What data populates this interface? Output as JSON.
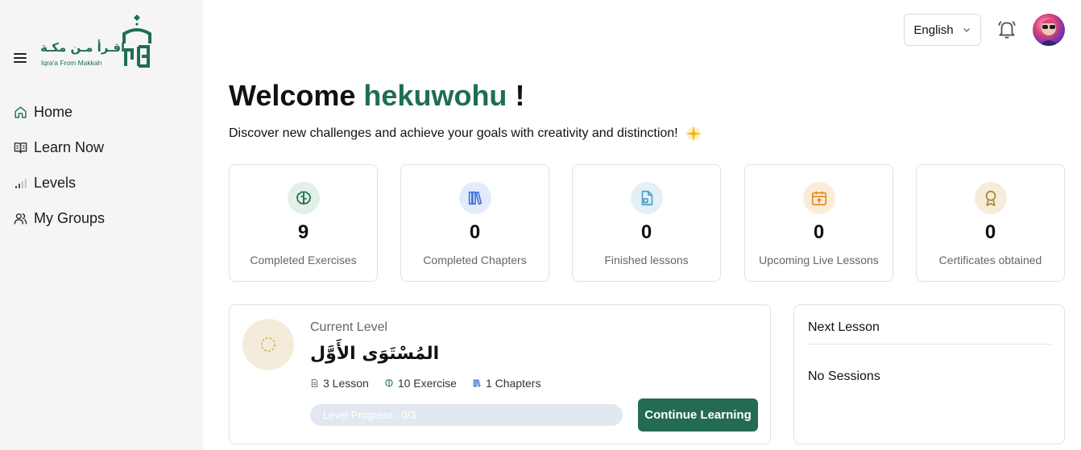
{
  "brand": {
    "name_ar": "اقـرأ مـن مكـة",
    "name_en": "Iqra'a From Makkah",
    "color": "#1f6f4f"
  },
  "sidebar": {
    "items": [
      {
        "label": "Home",
        "icon": "home-icon"
      },
      {
        "label": "Learn Now",
        "icon": "book-open-icon"
      },
      {
        "label": "Levels",
        "icon": "signal-bars-icon"
      },
      {
        "label": "My Groups",
        "icon": "users-icon"
      }
    ]
  },
  "header": {
    "language": "English",
    "language_icon": "chevron-down-icon",
    "notification_icon": "bell-icon",
    "avatar_icon": "user-avatar"
  },
  "welcome": {
    "greeting": "Welcome",
    "username": "hekuwohu",
    "exclaim": "!",
    "subtitle": "Discover new challenges and achieve your goals with creativity and distinction!",
    "sparkle_icon": "sparkle-icon"
  },
  "stats": [
    {
      "value": "9",
      "label": "Completed Exercises",
      "icon": "brain-icon",
      "bg": "#e3efe9",
      "color": "#1f6f4f"
    },
    {
      "value": "0",
      "label": "Completed Chapters",
      "icon": "books-icon",
      "bg": "#e3ebfb",
      "color": "#3b6fd8"
    },
    {
      "value": "0",
      "label": "Finished lessons",
      "icon": "document-icon",
      "bg": "#e3f0f6",
      "color": "#4f9ccc"
    },
    {
      "value": "0",
      "label": "Upcoming Live Lessons",
      "icon": "calendar-icon",
      "bg": "#fbecd8",
      "color": "#e08a1e"
    },
    {
      "value": "0",
      "label": "Certificates obtained",
      "icon": "award-icon",
      "bg": "#f5ecd9",
      "color": "#a8862d"
    }
  ],
  "current_level": {
    "caption": "Current Level",
    "name": "المُسْتَوَى الأَوَّل",
    "lessons": "3 Lesson",
    "exercises": "10 Exercise",
    "chapters": "1 Chapters",
    "progress_text": "Level Progress : 0/3",
    "progress_fraction": 0,
    "continue_label": "Continue Learning"
  },
  "next_lesson": {
    "title": "Next Lesson",
    "empty_text": "No Sessions"
  }
}
